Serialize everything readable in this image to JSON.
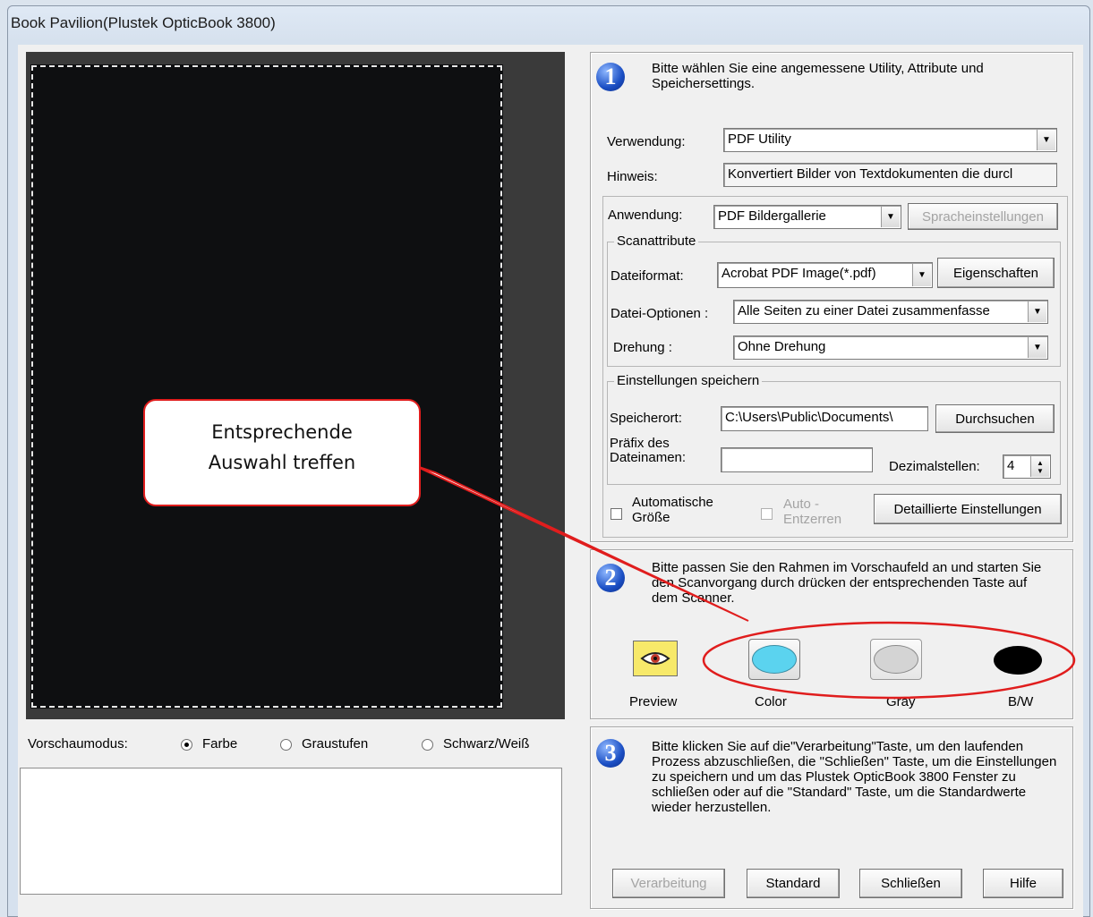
{
  "window": {
    "title": "Book Pavilion(Plustek OpticBook 3800)"
  },
  "preview_mode": {
    "label": "Vorschaumodus:",
    "options": [
      {
        "label": "Farbe",
        "selected": true
      },
      {
        "label": "Graustufen",
        "selected": false
      },
      {
        "label": "Schwarz/Weiß",
        "selected": false
      }
    ]
  },
  "step1": {
    "number": "1",
    "description": "Bitte wählen Sie eine angemessene Utility, Attribute und Speichersettings.",
    "verwendung_label": "Verwendung:",
    "verwendung_value": "PDF Utility",
    "hinweis_label": "Hinweis:",
    "hinweis_value": "Konvertiert Bilder von Textdokumenten die durcl",
    "anwendung_label": "Anwendung:",
    "anwendung_value": "PDF Bildergallerie",
    "sprache_button": "Spracheinstellungen",
    "scanattribute_legend": "Scanattribute",
    "dateiformat_label": "Dateiformat:",
    "dateiformat_value": "Acrobat PDF Image(*.pdf)",
    "eigenschaften_button": "Eigenschaften",
    "dateioptionen_label": "Datei-Optionen :",
    "dateioptionen_value": "Alle Seiten zu einer Datei zusammenfasse",
    "drehung_label": "Drehung :",
    "drehung_value": "Ohne Drehung",
    "einstellungen_legend": "Einstellungen speichern",
    "speicherort_label": "Speicherort:",
    "speicherort_value": "C:\\Users\\Public\\Documents\\",
    "durchsuchen_button": "Durchsuchen",
    "praefix_label_1": "Präfix des",
    "praefix_label_2": "Dateinamen:",
    "praefix_value": "",
    "dezimal_label": "Dezimalstellen:",
    "dezimal_value": "4",
    "auto_groesse_1": "Automatische",
    "auto_groesse_2": "Größe",
    "auto_entzerren_1": "Auto -",
    "auto_entzerren_2": "Entzerren",
    "detail_button": "Detaillierte Einstellungen"
  },
  "step2": {
    "number": "2",
    "description": "Bitte passen Sie den Rahmen im Vorschaufeld an und starten Sie den Scanvorgang durch drücken der entsprechenden Taste auf dem Scanner.",
    "buttons": [
      "Preview",
      "Color",
      "Gray",
      "B/W"
    ]
  },
  "step3": {
    "number": "3",
    "description": "Bitte klicken Sie auf die\"Verarbeitung\"Taste, um den laufenden Prozess abzuschließen, die \"Schließen\" Taste, um die Einstellungen zu speichern und um das Plustek OpticBook 3800 Fenster zu schließen oder auf die \"Standard\" Taste, um die Standardwerte wieder herzustellen.",
    "buttons": [
      "Verarbeitung",
      "Standard",
      "Schließen",
      "Hilfe"
    ]
  },
  "callout": {
    "line1": "Entsprechende",
    "line2": "Auswahl treffen"
  },
  "colors": {
    "annotation_red": "#e01d1d",
    "color_button": "#5bd3ef",
    "gray_button": "#d4d4d4",
    "bw_button": "#000000"
  }
}
